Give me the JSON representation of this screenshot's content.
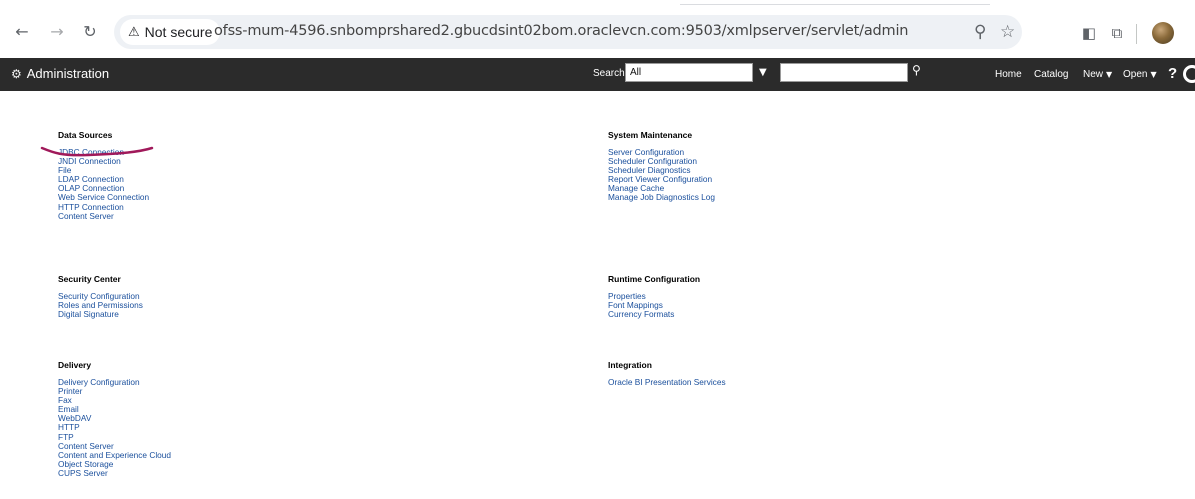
{
  "browser": {
    "security_label": "Not secure",
    "url": "ofss-mum-4596.snbomprshared2.gbucdsint02bom.oraclevcn.com:9503/xmlpserver/servlet/admin"
  },
  "header": {
    "title": "Administration",
    "search_label": "Search",
    "search_scope": "All",
    "search_value": "",
    "nav": {
      "home": "Home",
      "catalog": "Catalog",
      "new": "New",
      "open": "Open",
      "help": "?"
    }
  },
  "sections": {
    "data_sources": {
      "title": "Data Sources",
      "links": [
        "JDBC Connection",
        "JNDI Connection",
        "File",
        "LDAP Connection",
        "OLAP Connection",
        "Web Service Connection",
        "HTTP Connection",
        "Content Server"
      ]
    },
    "system_maintenance": {
      "title": "System Maintenance",
      "links": [
        "Server Configuration",
        "Scheduler Configuration",
        "Scheduler Diagnostics",
        "Report Viewer Configuration",
        "Manage Cache",
        "Manage Job Diagnostics Log"
      ]
    },
    "security_center": {
      "title": "Security Center",
      "links": [
        "Security Configuration",
        "Roles and Permissions",
        "Digital Signature"
      ]
    },
    "runtime_configuration": {
      "title": "Runtime Configuration",
      "links": [
        "Properties",
        "Font Mappings",
        "Currency Formats"
      ]
    },
    "delivery": {
      "title": "Delivery",
      "links": [
        "Delivery Configuration",
        "Printer",
        "Fax",
        "Email",
        "WebDAV",
        "HTTP",
        "FTP",
        "Content Server",
        "Content and Experience Cloud",
        "Object Storage",
        "CUPS Server"
      ]
    },
    "integration": {
      "title": "Integration",
      "links": [
        "Oracle BI Presentation Services"
      ]
    }
  },
  "annotation": {
    "color": "#a0195a"
  }
}
